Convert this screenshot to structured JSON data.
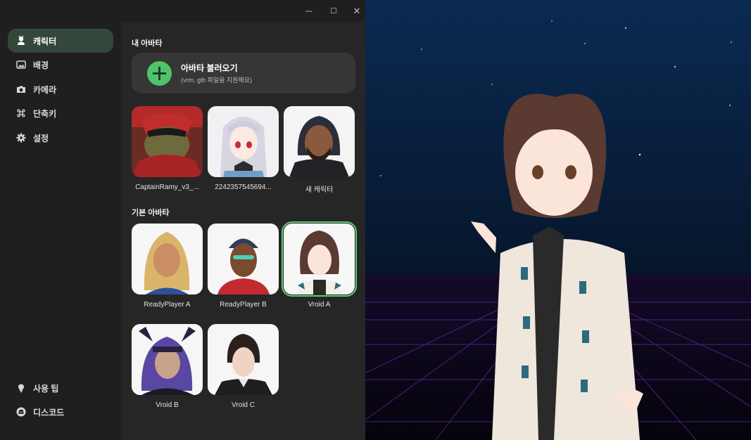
{
  "sidebar": {
    "items": [
      {
        "label": "캐릭터",
        "icon": "character-icon",
        "active": true
      },
      {
        "label": "배경",
        "icon": "image-icon"
      },
      {
        "label": "카메라",
        "icon": "camera-icon"
      },
      {
        "label": "단축키",
        "icon": "command-icon"
      },
      {
        "label": "설정",
        "icon": "gear-icon"
      }
    ],
    "bottom": [
      {
        "label": "사용 팁",
        "icon": "lightbulb-icon"
      },
      {
        "label": "디스코드",
        "icon": "discord-icon"
      }
    ]
  },
  "window": {
    "minimize": "─",
    "maximize": "☐",
    "close": "✕"
  },
  "my_avatars": {
    "title": "내 아바타",
    "import": {
      "title": "아바타 불러오기",
      "subtitle": "(vrm, glb 파일을 지원해요)"
    },
    "items": [
      "CaptainRamy_v3_...",
      "2242357545694...",
      "새 캐릭터"
    ]
  },
  "default_avatars": {
    "title": "기본 아바타",
    "items": [
      "ReadyPlayer A",
      "ReadyPlayer B",
      "Vroid A",
      "Vroid B",
      "Vroid C"
    ],
    "selected": "Vroid A"
  },
  "colors": {
    "accent": "#4fc46a",
    "sidebar_bg": "#1f1f1f",
    "panel_bg": "#262626",
    "card_bg": "#363636"
  }
}
